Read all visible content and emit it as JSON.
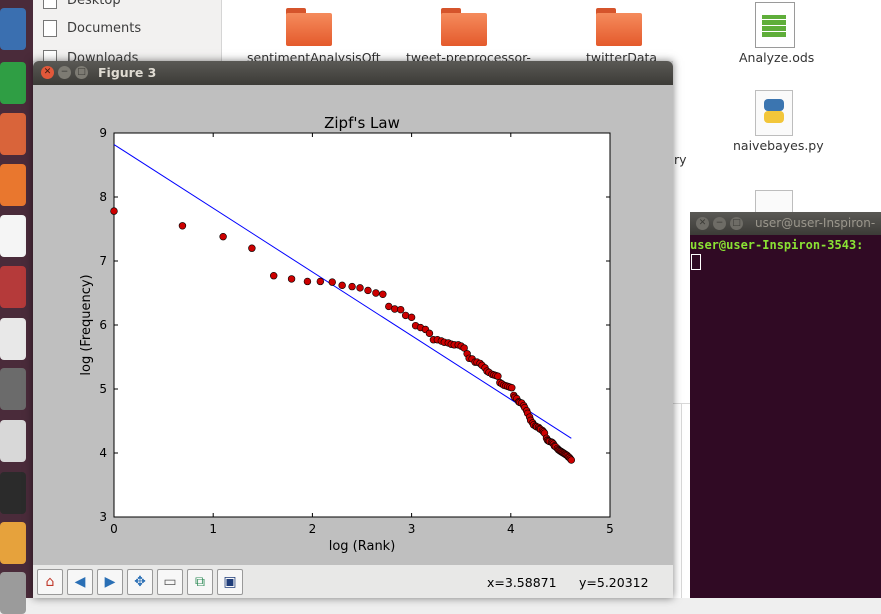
{
  "file_manager": {
    "sidebar": [
      {
        "label": "Desktop",
        "icon": "folder-icon"
      },
      {
        "label": "Documents",
        "icon": "document-icon"
      },
      {
        "label": "Downloads",
        "icon": "download-icon"
      }
    ],
    "files": [
      {
        "name": "sentimentAnalysisOft",
        "type": "folder"
      },
      {
        "name": "tweet-preprocessor-",
        "type": "folder"
      },
      {
        "name": "twitterData",
        "type": "folder"
      },
      {
        "name": "Analyze.ods",
        "type": "spreadsheet"
      },
      {
        "name": "naivebayes.py",
        "type": "python"
      }
    ],
    "partial_label": "ry"
  },
  "figure_window": {
    "title": "Figure 3",
    "toolbar": {
      "buttons": [
        "home-icon",
        "back-icon",
        "forward-icon",
        "pan-icon",
        "zoom-icon",
        "configure-subplots-icon",
        "save-icon"
      ],
      "x_readout": "x=3.58871",
      "y_readout": "y=5.20312"
    }
  },
  "terminal": {
    "title": "user@user-Inspiron-",
    "prompt": "user@user-Inspiron-3543:"
  },
  "chart_data": {
    "type": "scatter",
    "title": "Zipf's Law",
    "xlabel": "log (Rank)",
    "ylabel": "log (Frequency)",
    "xlim": [
      0,
      5
    ],
    "ylim": [
      3,
      9
    ],
    "xticks": [
      "0",
      "1",
      "2",
      "3",
      "4",
      "5"
    ],
    "yticks": [
      "3",
      "4",
      "5",
      "6",
      "7",
      "8",
      "9"
    ],
    "grid": false,
    "series": [
      {
        "kind": "points",
        "color": "#cc0000",
        "points": [
          [
            0,
            7.78
          ],
          [
            0.69,
            7.55
          ],
          [
            1.1,
            7.38
          ],
          [
            1.39,
            7.2
          ],
          [
            1.61,
            6.77
          ],
          [
            1.79,
            6.72
          ],
          [
            1.95,
            6.68
          ],
          [
            2.08,
            6.68
          ],
          [
            2.2,
            6.67
          ],
          [
            2.3,
            6.62
          ],
          [
            2.4,
            6.6
          ],
          [
            2.48,
            6.58
          ],
          [
            2.56,
            6.54
          ],
          [
            2.64,
            6.5
          ],
          [
            2.71,
            6.48
          ],
          [
            2.77,
            6.29
          ],
          [
            2.83,
            6.25
          ],
          [
            2.89,
            6.24
          ],
          [
            2.94,
            6.15
          ],
          [
            3.0,
            6.12
          ],
          [
            3.04,
            5.99
          ],
          [
            3.09,
            5.96
          ],
          [
            3.14,
            5.93
          ],
          [
            3.18,
            5.87
          ],
          [
            3.22,
            5.77
          ],
          [
            3.26,
            5.77
          ],
          [
            3.3,
            5.75
          ],
          [
            3.33,
            5.73
          ],
          [
            3.37,
            5.72
          ],
          [
            3.4,
            5.7
          ],
          [
            3.43,
            5.69
          ],
          [
            3.47,
            5.69
          ],
          [
            3.5,
            5.67
          ],
          [
            3.53,
            5.64
          ],
          [
            3.56,
            5.55
          ],
          [
            3.58,
            5.48
          ],
          [
            3.61,
            5.47
          ],
          [
            3.64,
            5.42
          ],
          [
            3.66,
            5.42
          ],
          [
            3.69,
            5.4
          ],
          [
            3.71,
            5.37
          ],
          [
            3.74,
            5.33
          ],
          [
            3.76,
            5.28
          ],
          [
            3.78,
            5.26
          ],
          [
            3.81,
            5.23
          ],
          [
            3.83,
            5.22
          ],
          [
            3.85,
            5.21
          ],
          [
            3.87,
            5.2
          ],
          [
            3.89,
            5.1
          ],
          [
            3.91,
            5.08
          ],
          [
            3.93,
            5.06
          ],
          [
            3.95,
            5.05
          ],
          [
            3.97,
            5.04
          ],
          [
            3.99,
            5.03
          ],
          [
            4.01,
            5.02
          ],
          [
            4.03,
            4.9
          ],
          [
            4.04,
            4.87
          ],
          [
            4.06,
            4.85
          ],
          [
            4.08,
            4.8
          ],
          [
            4.09,
            4.79
          ],
          [
            4.11,
            4.78
          ],
          [
            4.13,
            4.74
          ],
          [
            4.14,
            4.71
          ],
          [
            4.16,
            4.66
          ],
          [
            4.17,
            4.62
          ],
          [
            4.19,
            4.56
          ],
          [
            4.2,
            4.51
          ],
          [
            4.22,
            4.47
          ],
          [
            4.23,
            4.44
          ],
          [
            4.25,
            4.42
          ],
          [
            4.26,
            4.41
          ],
          [
            4.28,
            4.4
          ],
          [
            4.29,
            4.38
          ],
          [
            4.3,
            4.37
          ],
          [
            4.32,
            4.35
          ],
          [
            4.33,
            4.33
          ],
          [
            4.34,
            4.31
          ],
          [
            4.36,
            4.23
          ],
          [
            4.37,
            4.2
          ],
          [
            4.38,
            4.19
          ],
          [
            4.39,
            4.18
          ],
          [
            4.41,
            4.17
          ],
          [
            4.42,
            4.16
          ],
          [
            4.43,
            4.14
          ],
          [
            4.44,
            4.11
          ],
          [
            4.45,
            4.1
          ],
          [
            4.47,
            4.07
          ],
          [
            4.48,
            4.05
          ],
          [
            4.49,
            4.04
          ],
          [
            4.5,
            4.03
          ],
          [
            4.51,
            4.02
          ],
          [
            4.52,
            4.01
          ],
          [
            4.53,
            4.0
          ],
          [
            4.54,
            3.99
          ],
          [
            4.55,
            3.98
          ],
          [
            4.56,
            3.97
          ],
          [
            4.57,
            3.96
          ],
          [
            4.58,
            3.94
          ],
          [
            4.59,
            3.93
          ],
          [
            4.6,
            3.91
          ],
          [
            4.61,
            3.89
          ]
        ]
      },
      {
        "kind": "line",
        "color": "#0000ff",
        "points": [
          [
            0,
            8.82
          ],
          [
            4.61,
            4.23
          ]
        ]
      }
    ]
  }
}
